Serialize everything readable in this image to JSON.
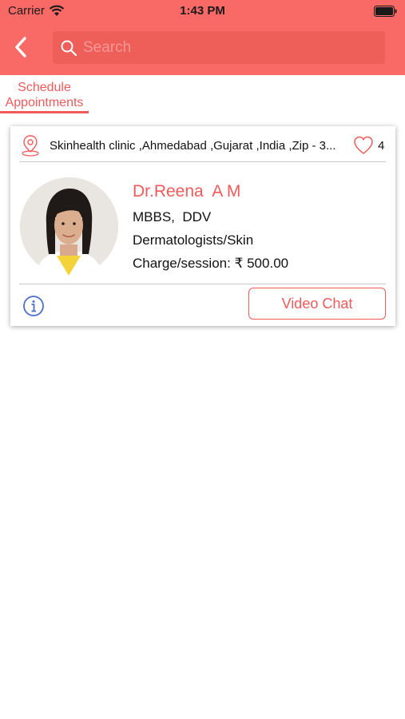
{
  "status_bar": {
    "carrier": "Carrier",
    "time": "1:43 PM"
  },
  "header": {
    "background_color": "#f96a66",
    "back_icon": "chevron-left-icon",
    "search": {
      "placeholder": "Search",
      "value": ""
    }
  },
  "tabs": [
    {
      "label": "Schedule\nAppointments",
      "selected": true
    }
  ],
  "doctor_card": {
    "address": "Skinhealth clinic ,Ahmedabad ,Gujarat ,India ,Zip - 3...",
    "likes": "4",
    "name": "Dr.Reena  A M",
    "qualification": "MBBS,  DDV",
    "specialization": "Dermatologists/Skin",
    "charge": "Charge/session: ₹ 500.00",
    "video_chat_label": "Video Chat",
    "accent_color": "#f05a5a",
    "info_icon_color": "#4a6fc4"
  }
}
